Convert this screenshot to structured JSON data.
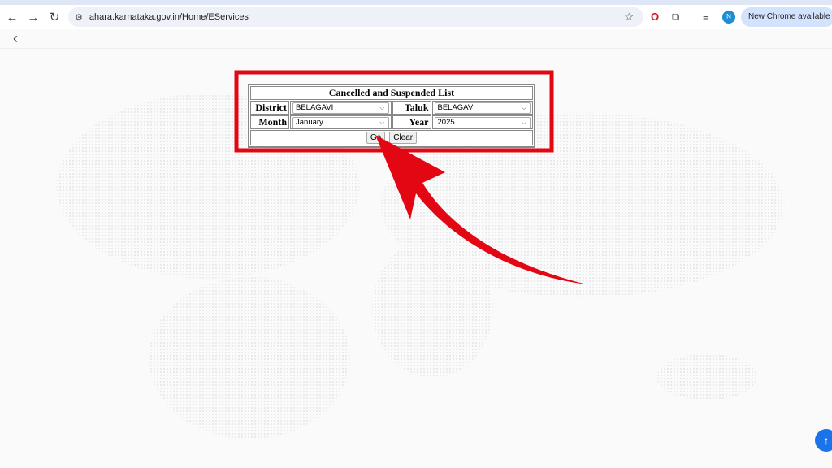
{
  "browser": {
    "url": "ahara.karnataka.gov.in/Home/EServices",
    "new_chrome_label": "New Chrome available",
    "avatar_letter": "N",
    "icons": [
      "back-icon",
      "forward-icon",
      "reload-icon",
      "site-settings-icon",
      "bookmark-star-icon",
      "opera-icon",
      "extensions-icon",
      "reading-list-icon"
    ]
  },
  "page": {
    "back_icon": "chevron-left-icon"
  },
  "form": {
    "title": "Cancelled and Suspended List",
    "district_label": "District",
    "district_value": "BELAGAVI",
    "taluk_label": "Taluk",
    "taluk_value": "BELAGAVI",
    "month_label": "Month",
    "month_value": "January",
    "year_label": "Year",
    "year_value": "2025",
    "go_label": "Go",
    "clear_label": "Clear"
  },
  "annotation": {
    "color": "#e30613"
  },
  "scroll_top_icon": "arrow-up-icon"
}
